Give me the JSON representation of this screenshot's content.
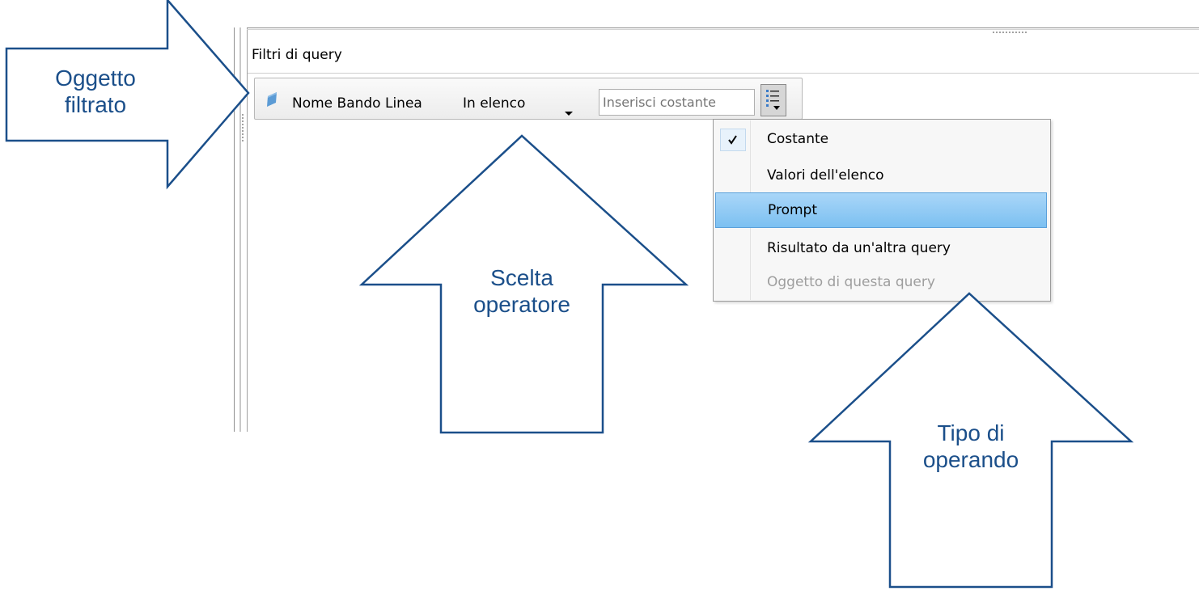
{
  "panel": {
    "title": "Filtri di query"
  },
  "filter": {
    "object_name": "Nome Bando Linea",
    "operator": "In elenco",
    "constant_placeholder": "Inserisci costante"
  },
  "operand_menu": {
    "items": [
      {
        "label": "Costante",
        "checked": true,
        "state": "normal"
      },
      {
        "label": "Valori dell'elenco",
        "checked": false,
        "state": "normal"
      },
      {
        "label": "Prompt",
        "checked": false,
        "state": "highlighted"
      },
      {
        "label": "Risultato da un'altra query",
        "checked": false,
        "state": "normal"
      },
      {
        "label": "Oggetto di questa query",
        "checked": false,
        "state": "disabled"
      }
    ]
  },
  "annotations": {
    "filtered_object": {
      "line1": "Oggetto",
      "line2": "filtrato"
    },
    "operator_choice": {
      "line1": "Scelta",
      "line2": "operatore"
    },
    "operand_type": {
      "line1": "Tipo di",
      "line2": "operando"
    }
  },
  "colors": {
    "annotation_blue": "#1b4f8a",
    "menu_highlight": "#86c5f3",
    "object_icon": "#5b9bd5"
  }
}
